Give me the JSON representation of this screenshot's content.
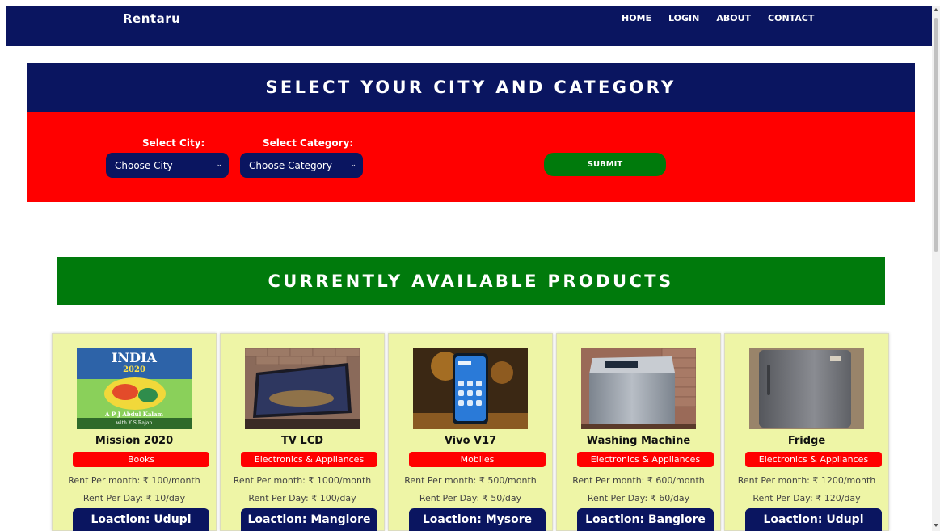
{
  "app": {
    "brand": "Rentaru"
  },
  "nav": {
    "items": [
      {
        "label": "HOME"
      },
      {
        "label": "LOGIN"
      },
      {
        "label": "ABOUT"
      },
      {
        "label": "CONTACT"
      }
    ]
  },
  "select_section": {
    "title": "SELECT YOUR CITY AND CATEGORY",
    "city_label": "Select City:",
    "city_value": "Choose City",
    "category_label": "Select Category:",
    "category_value": "Choose Category",
    "submit_label": "SUBMIT"
  },
  "products_section": {
    "title": "CURRENTLY AVAILABLE PRODUCTS"
  },
  "products": [
    {
      "name": "Mission 2020",
      "category": "Books",
      "rent_month": "Rent Per month: ₹ 100/month",
      "rent_day": "Rent Per Day: ₹ 10/day",
      "location": "Loaction: Udupi",
      "image": {
        "kind": "book-cover",
        "cover_title": "INDIA",
        "cover_subtitle": "2020",
        "author": "A P J Abdul Kalam",
        "coauthor": "with Y S Rajan"
      }
    },
    {
      "name": "TV LCD",
      "category": "Electronics & Appliances",
      "rent_month": "Rent Per month: ₹ 1000/month",
      "rent_day": "Rent Per Day: ₹ 100/day",
      "location": "Loaction: Manglore",
      "image": {
        "kind": "tv"
      }
    },
    {
      "name": "Vivo V17",
      "category": "Mobiles",
      "rent_month": "Rent Per month: ₹ 500/month",
      "rent_day": "Rent Per Day: ₹ 50/day",
      "location": "Loaction: Mysore",
      "image": {
        "kind": "phone"
      }
    },
    {
      "name": "Washing Machine",
      "category": "Electronics & Appliances",
      "rent_month": "Rent Per month: ₹ 600/month",
      "rent_day": "Rent Per Day: ₹ 60/day",
      "location": "Loaction: Banglore",
      "image": {
        "kind": "washing-machine"
      }
    },
    {
      "name": "Fridge",
      "category": "Electronics & Appliances",
      "rent_month": "Rent Per month: ₹ 1200/month",
      "rent_day": "Rent Per Day: ₹ 120/day",
      "location": "Loaction: Udupi",
      "image": {
        "kind": "fridge"
      }
    }
  ],
  "colors": {
    "navy": "#0a1560",
    "red": "#ff0000",
    "green": "#007a0c",
    "card_bg": "#eef5a6"
  }
}
